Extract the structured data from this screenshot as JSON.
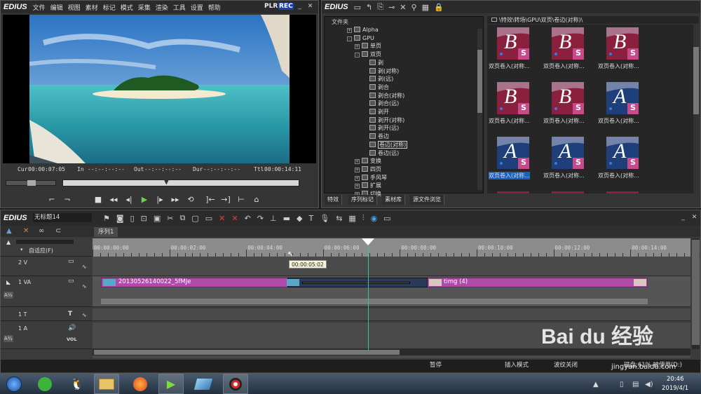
{
  "app": {
    "logo": "EDIUS",
    "brand_color": "#3d3d3d"
  },
  "player": {
    "menu": [
      "文件",
      "编辑",
      "视图",
      "素材",
      "标记",
      "模式",
      "采集",
      "渲染",
      "工具",
      "设置",
      "帮助"
    ],
    "mode_plr": "PLR",
    "mode_rec": "REC",
    "cur_label": "Cur",
    "cur_value": "00:00:07:05",
    "in_label": "In",
    "in_value": "--:--:--:--",
    "out_label": "Out",
    "out_value": "--:--:--:--",
    "dur_label": "Dur",
    "dur_value": "--:--:--:--",
    "ttl_label": "Ttl",
    "ttl_value": "00:00:14:11",
    "scrub_fraction": 0.44
  },
  "library": {
    "logo": "EDIUS",
    "folder_header": "文件夹",
    "path": "\\特效\\转场\\GPU\\双页\\卷边(对称)\\",
    "tree": [
      {
        "label": "Alpha",
        "level": 0,
        "expand": "+"
      },
      {
        "label": "GPU",
        "level": 0,
        "expand": "-"
      },
      {
        "label": "单页",
        "level": 1,
        "expand": "+"
      },
      {
        "label": "双页",
        "level": 1,
        "expand": "-"
      },
      {
        "label": "剥",
        "level": 2,
        "expand": ""
      },
      {
        "label": "剥(对称)",
        "level": 2,
        "expand": ""
      },
      {
        "label": "剥(远)",
        "level": 2,
        "expand": ""
      },
      {
        "label": "剥合",
        "level": 2,
        "expand": ""
      },
      {
        "label": "剥合(对称)",
        "level": 2,
        "expand": ""
      },
      {
        "label": "剥合(远)",
        "level": 2,
        "expand": ""
      },
      {
        "label": "剥开",
        "level": 2,
        "expand": ""
      },
      {
        "label": "剥开(对称)",
        "level": 2,
        "expand": ""
      },
      {
        "label": "剥开(远)",
        "level": 2,
        "expand": ""
      },
      {
        "label": "卷边",
        "level": 2,
        "expand": ""
      },
      {
        "label": "卷边(对称)",
        "level": 2,
        "expand": "",
        "selected": true
      },
      {
        "label": "卷边(远)",
        "level": 2,
        "expand": ""
      },
      {
        "label": "变换",
        "level": 1,
        "expand": "+"
      },
      {
        "label": "四页",
        "level": 1,
        "expand": "+"
      },
      {
        "label": "手风琴",
        "level": 1,
        "expand": "+"
      },
      {
        "label": "扩展",
        "level": 1,
        "expand": "+"
      },
      {
        "label": "切换",
        "level": 1,
        "expand": "+"
      }
    ],
    "thumbnails": [
      {
        "label": "双页卷入(对称...",
        "letter": "B",
        "bg": "#8a1f3e",
        "selected": false
      },
      {
        "label": "双页卷入(对称...",
        "letter": "B",
        "bg": "#8a1f3e",
        "selected": false
      },
      {
        "label": "双页卷入(对称...",
        "letter": "B",
        "bg": "#8a1f3e",
        "selected": false
      },
      {
        "label": "双页卷入(对称...",
        "letter": "B",
        "bg": "#8a1f3e",
        "selected": false
      },
      {
        "label": "双页卷入(对称...",
        "letter": "B",
        "bg": "#8a1f3e",
        "selected": false
      },
      {
        "label": "双页卷入(对称...",
        "letter": "A",
        "bg": "#1e3f7a",
        "selected": false
      },
      {
        "label": "双页卷入(对称...",
        "letter": "A",
        "bg": "#1e3f7a",
        "selected": true
      },
      {
        "label": "双页卷入(对称...",
        "letter": "A",
        "bg": "#1e3f7a",
        "selected": false
      },
      {
        "label": "双页卷入(对称...",
        "letter": "A",
        "bg": "#1e3f7a",
        "selected": false
      }
    ],
    "tabs": [
      "特效",
      "序列标记",
      "素材库",
      "源文件浏览"
    ]
  },
  "timeline": {
    "logo": "EDIUS",
    "project": "无标题14",
    "sequence_tab": "序列1",
    "fit_mode": "自适应(F)",
    "ruler_ticks": [
      "00:00:00:00",
      "00:00:02:00",
      "00:00:04:00",
      "00:00:06:00",
      "00:00:08:00",
      "00:00:10:00",
      "00:00:12:00",
      "00:00:14:00"
    ],
    "tooltip": "00:00:05:02",
    "tracks": [
      {
        "name": "2 V",
        "type": "V"
      },
      {
        "name": "1 VA",
        "type": "VA"
      },
      {
        "name": "1 T",
        "type": "T"
      },
      {
        "name": "1 A",
        "type": "A"
      }
    ],
    "clip1_label": "20130526140022_5fMJe",
    "clip2_label": "timg (4)",
    "vol_label": "VOL",
    "playhead_fraction": 0.461,
    "clip_color": "#b04aa8"
  },
  "status": {
    "pause": "暂停",
    "insert_mode": "插入模式",
    "ripple_off": "波纹关闭",
    "disk": "磁盘:61% 被使用(D:)"
  },
  "taskbar": {
    "time": "20:46",
    "date": "2019/4/1",
    "watermark": "Bai du 经验",
    "watermark_url": "jingyan.baidu.com"
  }
}
